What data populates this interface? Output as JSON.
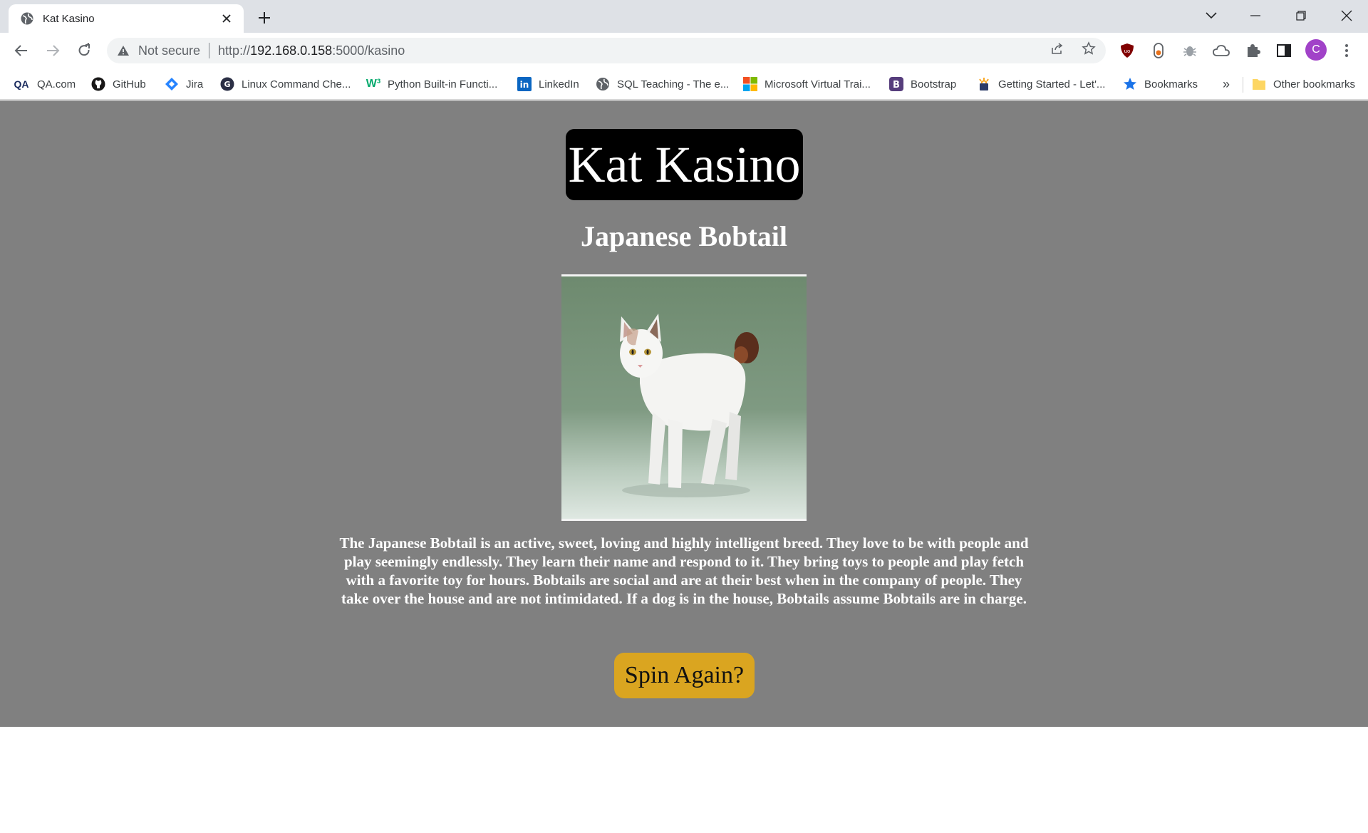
{
  "browser": {
    "tab_title": "Kat Kasino",
    "security_label": "Not secure",
    "url_scheme": "http://",
    "url_host": "192.168.0.158",
    "url_path": ":5000/kasino",
    "avatar_letter": "C"
  },
  "bookmarks": {
    "items": [
      {
        "label": "QA.com",
        "icon": "qa-icon"
      },
      {
        "label": "GitHub",
        "icon": "github-icon"
      },
      {
        "label": "Jira",
        "icon": "jira-icon"
      },
      {
        "label": "Linux Command Che...",
        "icon": "linux-icon"
      },
      {
        "label": "Python Built-in Functi...",
        "icon": "w3schools-icon"
      },
      {
        "label": "LinkedIn",
        "icon": "linkedin-icon"
      },
      {
        "label": "SQL Teaching - The e...",
        "icon": "globe-icon"
      },
      {
        "label": "Microsoft Virtual Trai...",
        "icon": "microsoft-icon"
      },
      {
        "label": "Bootstrap",
        "icon": "bootstrap-icon"
      },
      {
        "label": "Getting Started - Let'...",
        "icon": "letsencrypt-icon"
      },
      {
        "label": "Bookmarks",
        "icon": "star-icon"
      }
    ],
    "overflow": "»",
    "other": "Other bookmarks"
  },
  "page": {
    "site_title": "Kat Kasino",
    "breed_name": "Japanese Bobtail",
    "description": "The Japanese Bobtail is an active, sweet, loving and highly intelligent breed. They love to be with people and play seemingly endlessly. They learn their name and respond to it. They bring toys to people and play fetch with a favorite toy for hours. Bobtails are social and are at their best when in the company of people. They take over the house and are not intimidated. If a dog is in the house, Bobtails assume Bobtails are in charge.",
    "spin_button": "Spin Again?"
  },
  "colors": {
    "page_bg": "#808080",
    "title_bg": "#000000",
    "button_bg": "#daa520"
  }
}
